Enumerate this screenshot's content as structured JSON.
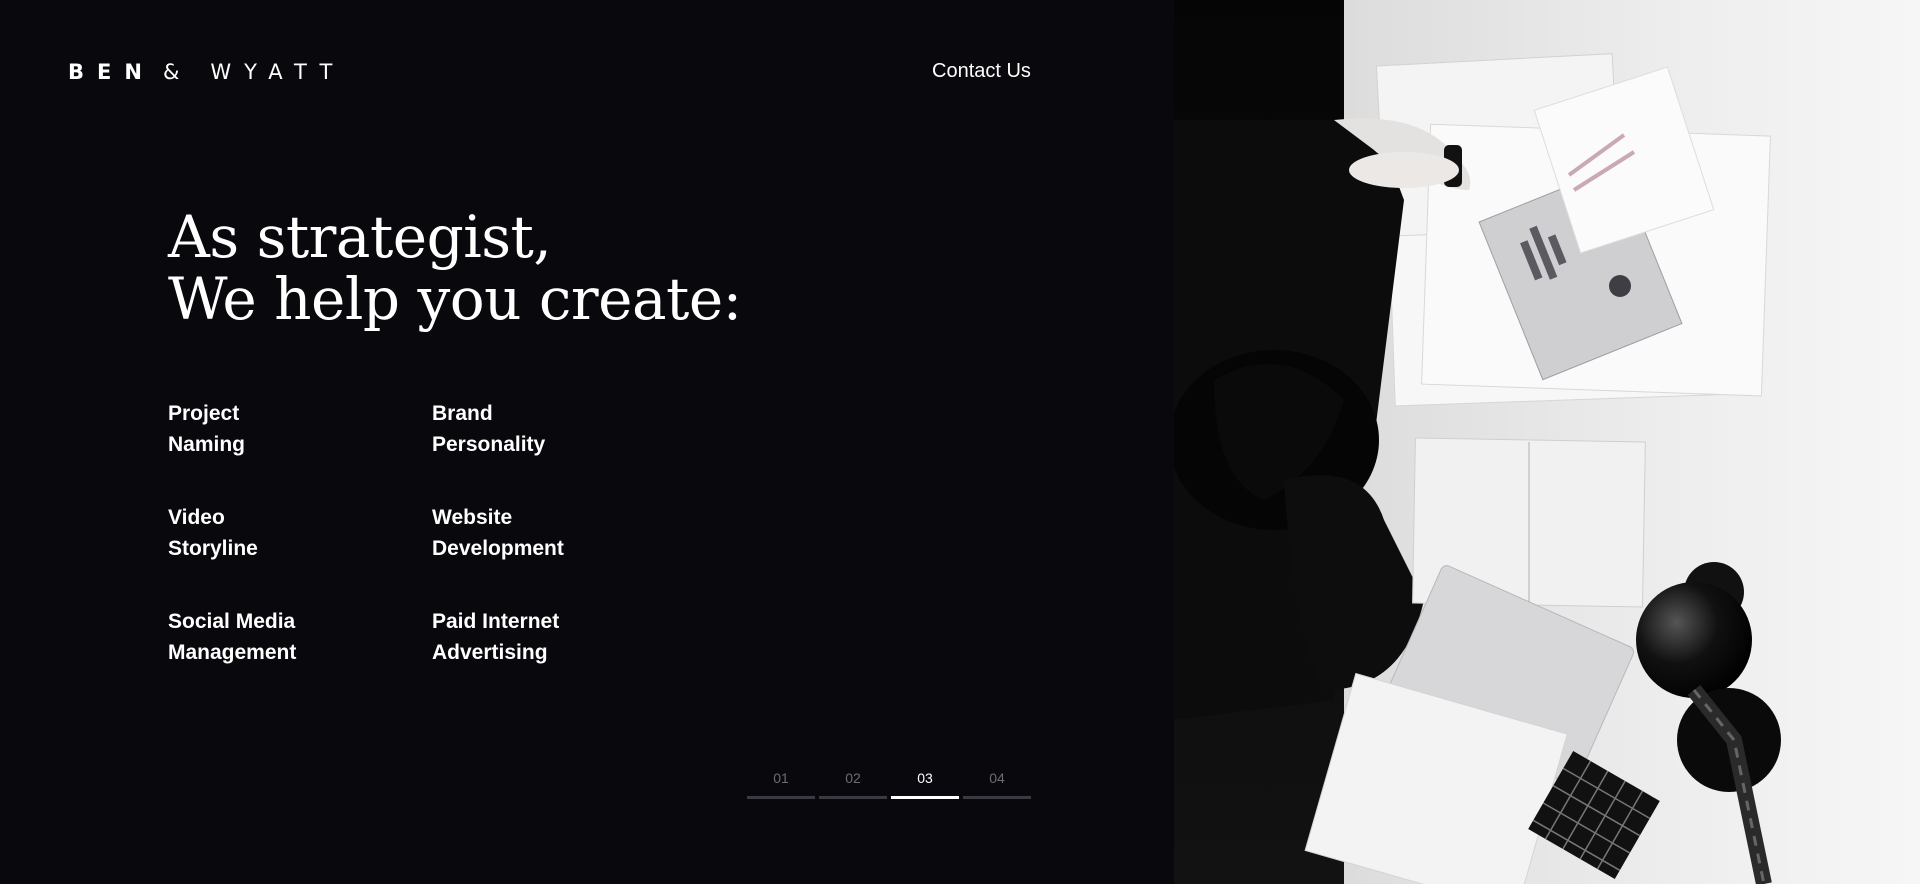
{
  "brand": {
    "word1": "BEN",
    "amp": "&",
    "word2": "WYATT"
  },
  "nav": {
    "contact_label": "Contact Us"
  },
  "headline": {
    "line1": "As strategist,",
    "line2": "We help you create:"
  },
  "services": [
    {
      "line1": "Project",
      "line2": "Naming"
    },
    {
      "line1": "Brand",
      "line2": "Personality"
    },
    {
      "line1": "Video",
      "line2": "Storyline"
    },
    {
      "line1": "Website",
      "line2": "Development"
    },
    {
      "line1": "Social Media",
      "line2": "Management"
    },
    {
      "line1": "Paid Internet",
      "line2": "Advertising"
    }
  ],
  "pager": {
    "items": [
      "01",
      "02",
      "03",
      "04"
    ],
    "active_index": 2
  },
  "colors": {
    "background": "#08080d",
    "text": "#ffffff",
    "muted": "#6c6c74",
    "inactive_bar": "#3a3a42"
  },
  "photo": {
    "description_icon": "desk-photo"
  }
}
